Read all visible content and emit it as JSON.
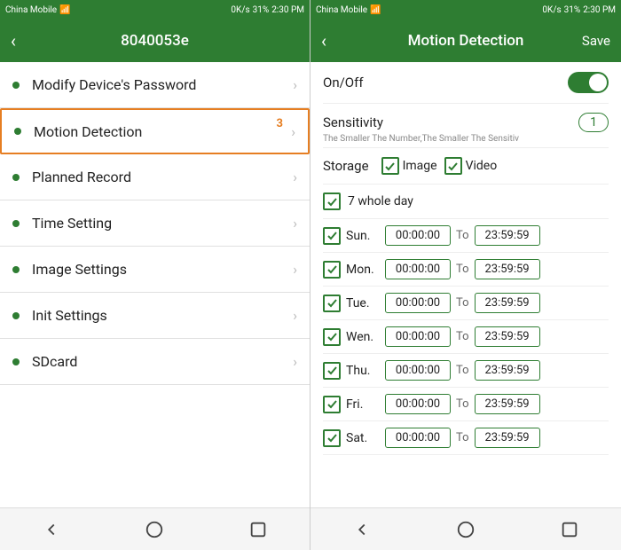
{
  "left_panel": {
    "status_bar": {
      "carrier": "China Mobile",
      "speed": "0K/s",
      "time": "2:30 PM",
      "battery": "31%"
    },
    "header": {
      "back_label": "‹",
      "title": "8040053e"
    },
    "menu_items": [
      {
        "id": "modify-password",
        "label": "Modify Device's Password",
        "active": false,
        "badge": null
      },
      {
        "id": "motion-detection",
        "label": "Motion Detection",
        "active": true,
        "badge": "3"
      },
      {
        "id": "planned-record",
        "label": "Planned Record",
        "active": false,
        "badge": null
      },
      {
        "id": "time-setting",
        "label": "Time Setting",
        "active": false,
        "badge": null
      },
      {
        "id": "image-settings",
        "label": "Image Settings",
        "active": false,
        "badge": null
      },
      {
        "id": "init-settings",
        "label": "Init Settings",
        "active": false,
        "badge": null
      },
      {
        "id": "sdcard",
        "label": "SDcard",
        "active": false,
        "badge": null
      }
    ]
  },
  "right_panel": {
    "status_bar": {
      "carrier": "China Mobile",
      "speed": "0K/s",
      "time": "2:30 PM",
      "battery": "31%"
    },
    "header": {
      "back_label": "‹",
      "title": "Motion Detection",
      "save_label": "Save"
    },
    "onoff_label": "On/Off",
    "sensitivity_label": "Sensitivity",
    "sensitivity_hint": "The Smaller The Number,The Smaller The Sensitiv",
    "sensitivity_value": "1",
    "storage_label": "Storage",
    "storage_image_label": "Image",
    "storage_video_label": "Video",
    "whole_day_label": "7 whole day",
    "days": [
      {
        "label": "Sun.",
        "from": "00:00:00",
        "to": "23:59:59"
      },
      {
        "label": "Mon.",
        "from": "00:00:00",
        "to": "23:59:59"
      },
      {
        "label": "Tue.",
        "from": "00:00:00",
        "to": "23:59:59"
      },
      {
        "label": "Wen.",
        "from": "00:00:00",
        "to": "23:59:59"
      },
      {
        "label": "Thu.",
        "from": "00:00:00",
        "to": "23:59:59"
      },
      {
        "label": "Fri.",
        "from": "00:00:00",
        "to": "23:59:59"
      },
      {
        "label": "Sat.",
        "from": "00:00:00",
        "to": "23:59:59"
      }
    ],
    "to_label": "To"
  },
  "colors": {
    "green": "#2e7d32",
    "orange": "#e67e22"
  }
}
